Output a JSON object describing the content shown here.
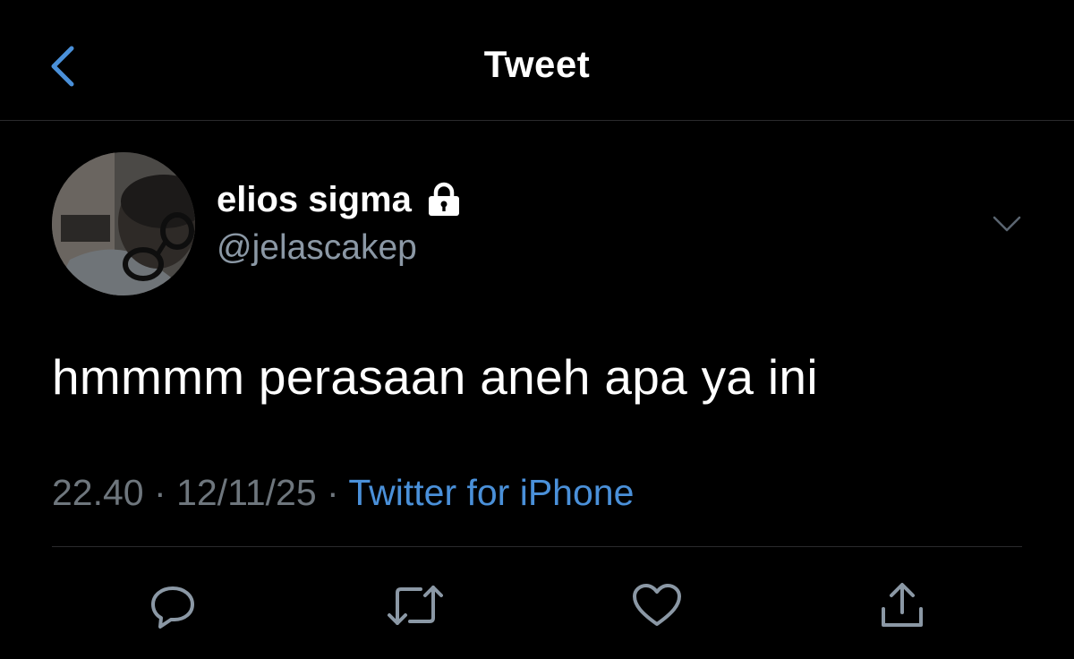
{
  "header": {
    "title": "Tweet",
    "back_icon": "chevron-left-icon"
  },
  "tweet": {
    "author": {
      "display_name": "elios sigma",
      "handle": "@jelascakep",
      "protected_icon": "lock-icon"
    },
    "text": "hmmmm perasaan aneh apa ya ini",
    "time": "22.40",
    "date": "12/11/25",
    "separator": "·",
    "source": "Twitter for iPhone",
    "more_icon": "chevron-down-icon"
  },
  "actions": [
    {
      "name": "reply",
      "icon": "reply-icon"
    },
    {
      "name": "retweet",
      "icon": "retweet-icon"
    },
    {
      "name": "like",
      "icon": "heart-icon"
    },
    {
      "name": "share",
      "icon": "share-icon"
    }
  ],
  "colors": {
    "background": "#000000",
    "accent": "#4a90d9",
    "secondary_text": "#8b98a5",
    "icon": "#8b98a5",
    "divider": "#2a2a2c"
  }
}
